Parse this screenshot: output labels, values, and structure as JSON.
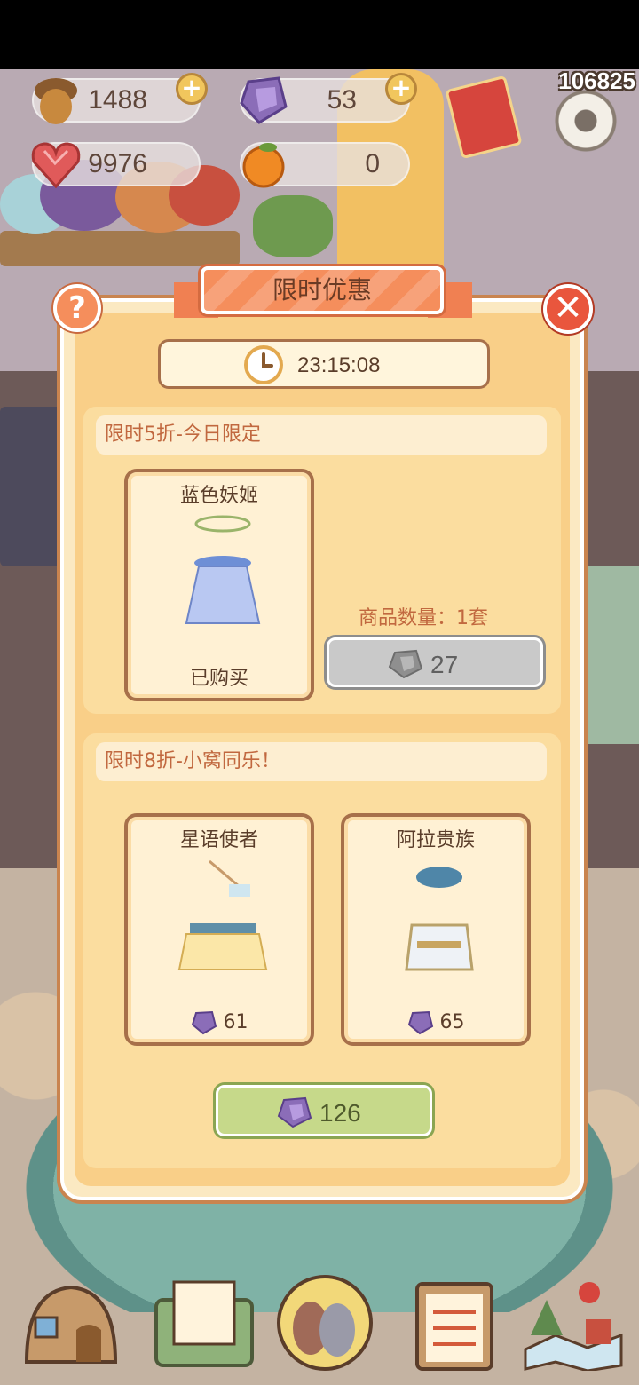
{
  "player_id": "106825",
  "resources": {
    "acorn": {
      "value": "1488",
      "icon": "acorn-icon"
    },
    "gem": {
      "value": "53",
      "icon": "purple-gem-icon"
    },
    "heart": {
      "value": "9976",
      "icon": "heart-gem-icon"
    },
    "orange": {
      "value": "0",
      "icon": "orange-icon"
    }
  },
  "modal": {
    "title": "限时优惠",
    "timer": "23:15:08",
    "section1": {
      "title": "限时5折-今日限定",
      "item": {
        "name": "蓝色妖姬",
        "status": "已购买"
      },
      "quantity_label": "商品数量：1套",
      "price": "27"
    },
    "section2": {
      "title": "限时8折-小窝同乐！",
      "items": [
        {
          "name": "星语使者",
          "price": "61"
        },
        {
          "name": "阿拉贵族",
          "price": "65"
        }
      ],
      "total_price": "126"
    }
  },
  "colors": {
    "modal_bg": "#f9cf88",
    "ribbon": "#f58e5c",
    "buy_button": "#c6d98a",
    "disabled_button": "#c9c9c9"
  },
  "nav": [
    {
      "icon": "house-icon"
    },
    {
      "icon": "mail-icon"
    },
    {
      "icon": "pets-icon"
    },
    {
      "icon": "task-clipboard-icon"
    },
    {
      "icon": "map-icon"
    }
  ]
}
